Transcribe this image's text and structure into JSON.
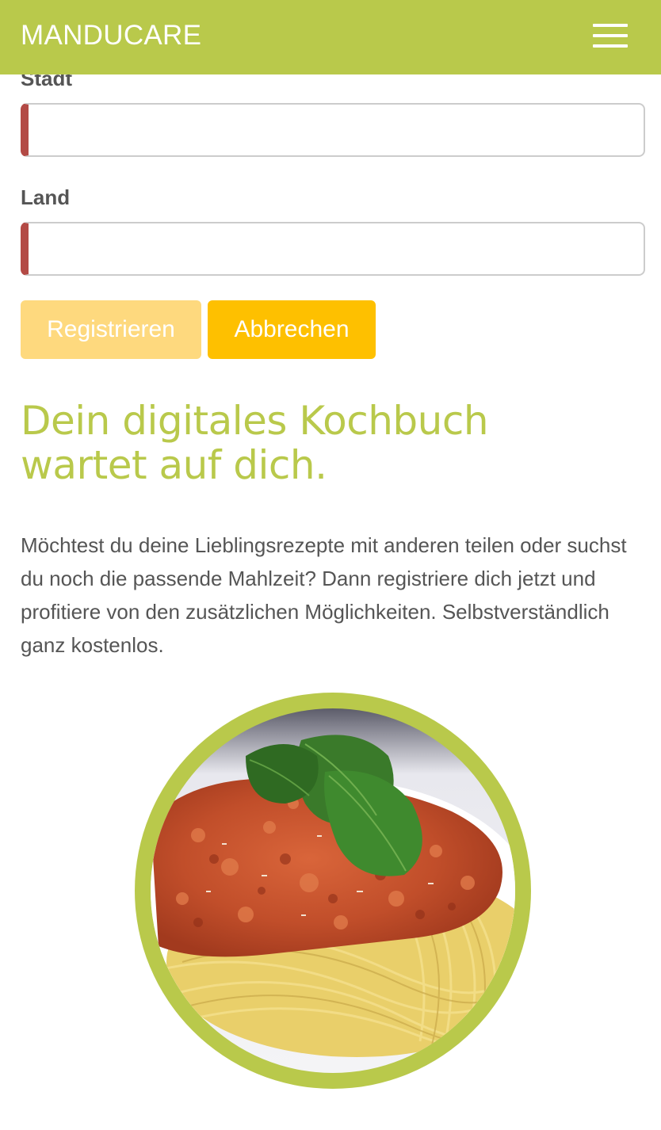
{
  "header": {
    "brand": "MANDUCARE",
    "menu_icon": "hamburger-menu-icon"
  },
  "form": {
    "city_label": "Stadt",
    "city_value": "",
    "country_label": "Land",
    "country_value": "",
    "register_label": "Registrieren",
    "cancel_label": "Abbrechen"
  },
  "promo": {
    "headline_line1": "Dein digitales Kochbuch",
    "headline_line2": "wartet auf dich.",
    "text": "Möchtest du deine Lieblingsrezepte mit anderen teilen oder suchst du noch die passende Mahlzeit? Dann registriere dich jetzt und profitiere von den zusätzlichen Möglichkeiten. Selbstverständlich ganz kostenlos."
  },
  "colors": {
    "brand_green": "#b9c94b",
    "button_yellow": "#fec000",
    "button_yellow_disabled": "#fed97e",
    "invalid_marker": "#b34a45",
    "text": "#555555"
  }
}
